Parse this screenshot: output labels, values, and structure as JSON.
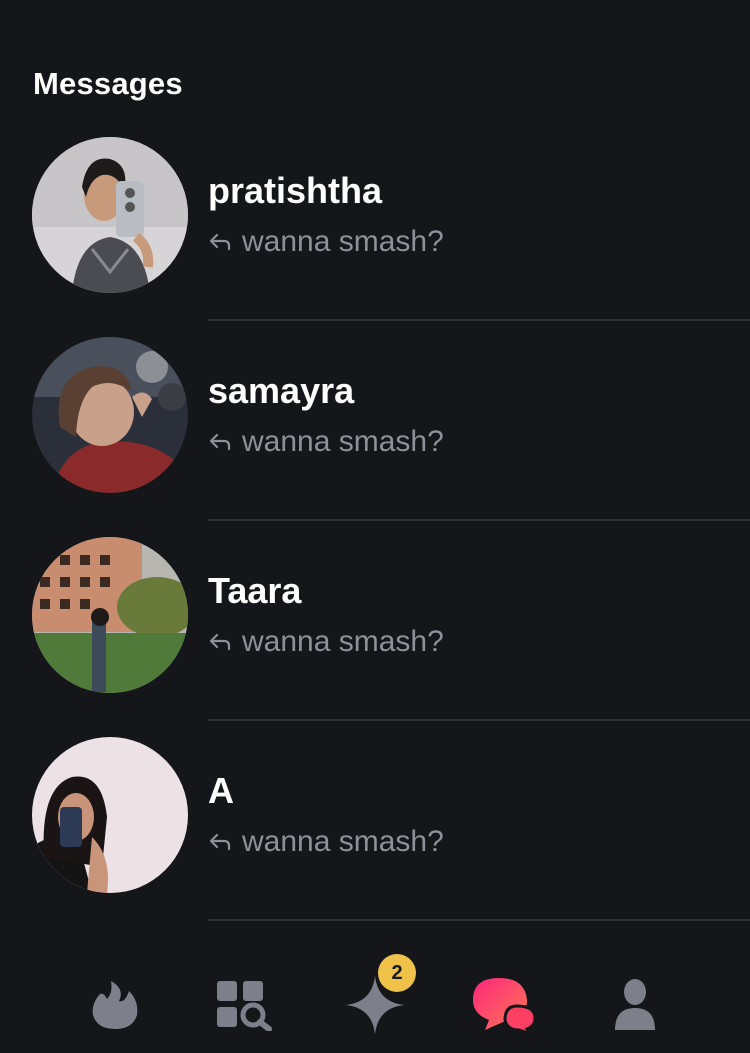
{
  "header": {
    "title": "Messages"
  },
  "conversations": [
    {
      "name": "pratishtha",
      "preview": "wanna smash?"
    },
    {
      "name": "samayra",
      "preview": "wanna smash?"
    },
    {
      "name": "Taara",
      "preview": "wanna smash?"
    },
    {
      "name": "A",
      "preview": "wanna smash?"
    }
  ],
  "nav": {
    "items": [
      {
        "icon": "flame-icon"
      },
      {
        "icon": "explore-grid-icon"
      },
      {
        "icon": "sparkle-icon",
        "badge": "2"
      },
      {
        "icon": "chat-bubbles-icon",
        "active": true
      },
      {
        "icon": "profile-icon"
      }
    ]
  },
  "colors": {
    "background": "#15161a",
    "text": "#ffffff",
    "muted": "#8e8f98",
    "divider": "#2f3036",
    "nav_inactive": "#7d7f8a",
    "accent_start": "#fd267d",
    "accent_end": "#ff7854",
    "badge": "#f0c24a"
  }
}
